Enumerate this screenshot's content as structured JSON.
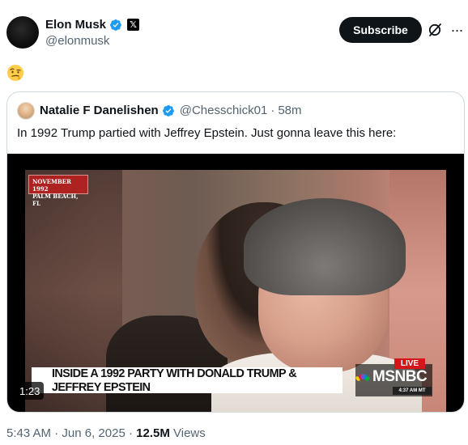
{
  "author": {
    "name": "Elon Musk",
    "handle": "@elonmusk",
    "badge_letter": "𝕏"
  },
  "header_actions": {
    "subscribe_label": "Subscribe",
    "more_label": "···"
  },
  "tweet": {
    "emoji": "🤨"
  },
  "quoted": {
    "name": "Natalie F Danelishen",
    "handle": "@Chesschick01",
    "separator": "·",
    "time": "58m",
    "text": "In 1992 Trump partied with Jeffrey Epstein. Just gonna leave this here:"
  },
  "video": {
    "date_line1": "NOVEMBER 1992",
    "date_line2": "PALM BEACH, FL",
    "headline": "INSIDE A 1992 PARTY WITH DONALD TRUMP & JEFFREY EPSTEIN",
    "live_label": "LIVE",
    "network": "MSNBC",
    "clock": "4:37 AM MT",
    "duration": "1:23"
  },
  "meta": {
    "time": "5:43 AM",
    "separator": "·",
    "date": "Jun 6, 2025",
    "views_count": "12.5M",
    "views_label": "Views"
  },
  "colors": {
    "verified_blue": "#1d9bf0",
    "text_primary": "#0f1419",
    "text_secondary": "#536471",
    "live_red": "#d4161b"
  }
}
